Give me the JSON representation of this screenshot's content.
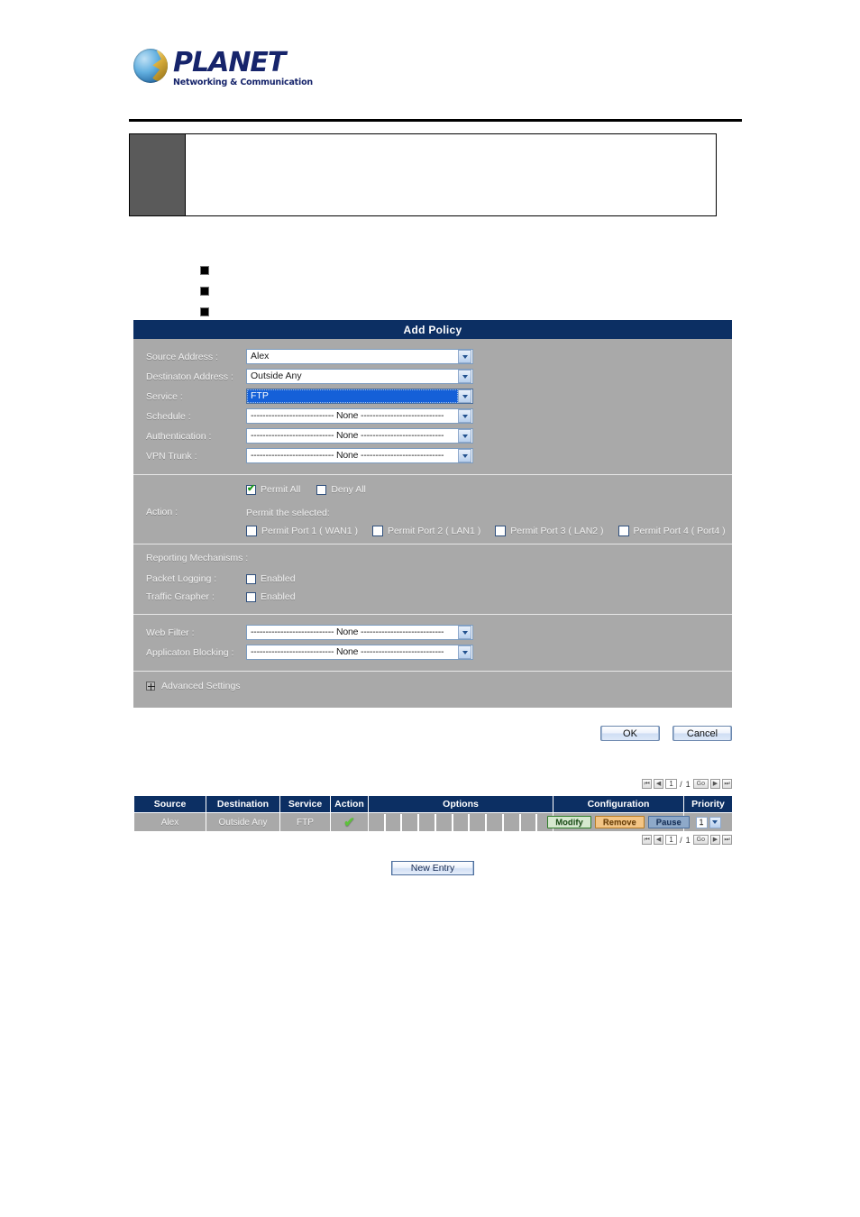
{
  "brand": {
    "name": "PLANET",
    "tagline": "Networking & Communication",
    "logo_icon": "planet-globe-icon"
  },
  "callout": {
    "icon": "note-icon",
    "text": ""
  },
  "bullets": [
    {
      "text": ""
    },
    {
      "text": ""
    },
    {
      "text": ""
    }
  ],
  "panel": {
    "title": "Add Policy",
    "fields": [
      {
        "label": "Source Address :",
        "value": "Alex",
        "focused": false
      },
      {
        "label": "Destinaton Address :",
        "value": "Outside Any",
        "focused": false
      },
      {
        "label": "Service :",
        "value": "FTP",
        "focused": true
      },
      {
        "label": "Schedule :",
        "value": "---------------------------- None ----------------------------",
        "focused": false
      },
      {
        "label": "Authentication :",
        "value": "---------------------------- None ----------------------------",
        "focused": false
      },
      {
        "label": "VPN Trunk :",
        "value": "---------------------------- None ----------------------------",
        "focused": false
      }
    ],
    "action": {
      "label": "Action :",
      "permit_all": {
        "label": "Permit All",
        "checked": true
      },
      "deny_all": {
        "label": "Deny All",
        "checked": false
      },
      "permit_selected_label": "Permit the selected:",
      "ports": [
        {
          "label": "Permit Port  1  ( WAN1 )",
          "checked": false
        },
        {
          "label": "Permit Port  2  ( LAN1 )",
          "checked": false
        },
        {
          "label": "Permit Port  3  ( LAN2 )",
          "checked": false
        },
        {
          "label": "Permit Port  4  ( Port4 )",
          "checked": false
        }
      ]
    },
    "reporting": {
      "title": "Reporting Mechanisms :",
      "rows": [
        {
          "label": "Packet Logging :",
          "checkbox_label": "Enabled",
          "checked": false
        },
        {
          "label": "Traffic Grapher :",
          "checkbox_label": "Enabled",
          "checked": false
        }
      ]
    },
    "filters": [
      {
        "label": "Web Filter :",
        "value": "---------------------------- None ----------------------------"
      },
      {
        "label": "Applicaton Blocking :",
        "value": "---------------------------- None ----------------------------"
      }
    ],
    "advanced": {
      "label": "Advanced Settings",
      "icon": "expand-plus-icon",
      "expanded": false
    },
    "buttons": {
      "ok": "OK",
      "cancel": "Cancel"
    }
  },
  "pager": {
    "first_icon": "first-page-icon",
    "prev_icon": "prev-page-icon",
    "page": "1",
    "separator": "/",
    "total": "1",
    "go": "Go",
    "next_icon": "next-page-icon",
    "last_icon": "last-page-icon"
  },
  "table": {
    "columns": [
      "Source",
      "Destination",
      "Service",
      "Action",
      "Options",
      "Configuration",
      "Priority"
    ],
    "option_cell_count": 11,
    "rows": [
      {
        "source": "Alex",
        "destination": "Outside Any",
        "service": "FTP",
        "action_icon": "green-check-icon",
        "action_symbol": "✔",
        "configuration": {
          "modify": "Modify",
          "remove": "Remove",
          "pause": "Pause"
        },
        "priority": "1"
      }
    ]
  },
  "new_entry": {
    "label": "New Entry"
  },
  "colors": {
    "panel_header": "#0c2f63",
    "panel_body": "#a9a9a9",
    "accent_check": "#5dc23a",
    "modify": "#2f7d28",
    "remove": "#b87c24",
    "pause": "#4a6f9e",
    "brand": "#16246b"
  }
}
